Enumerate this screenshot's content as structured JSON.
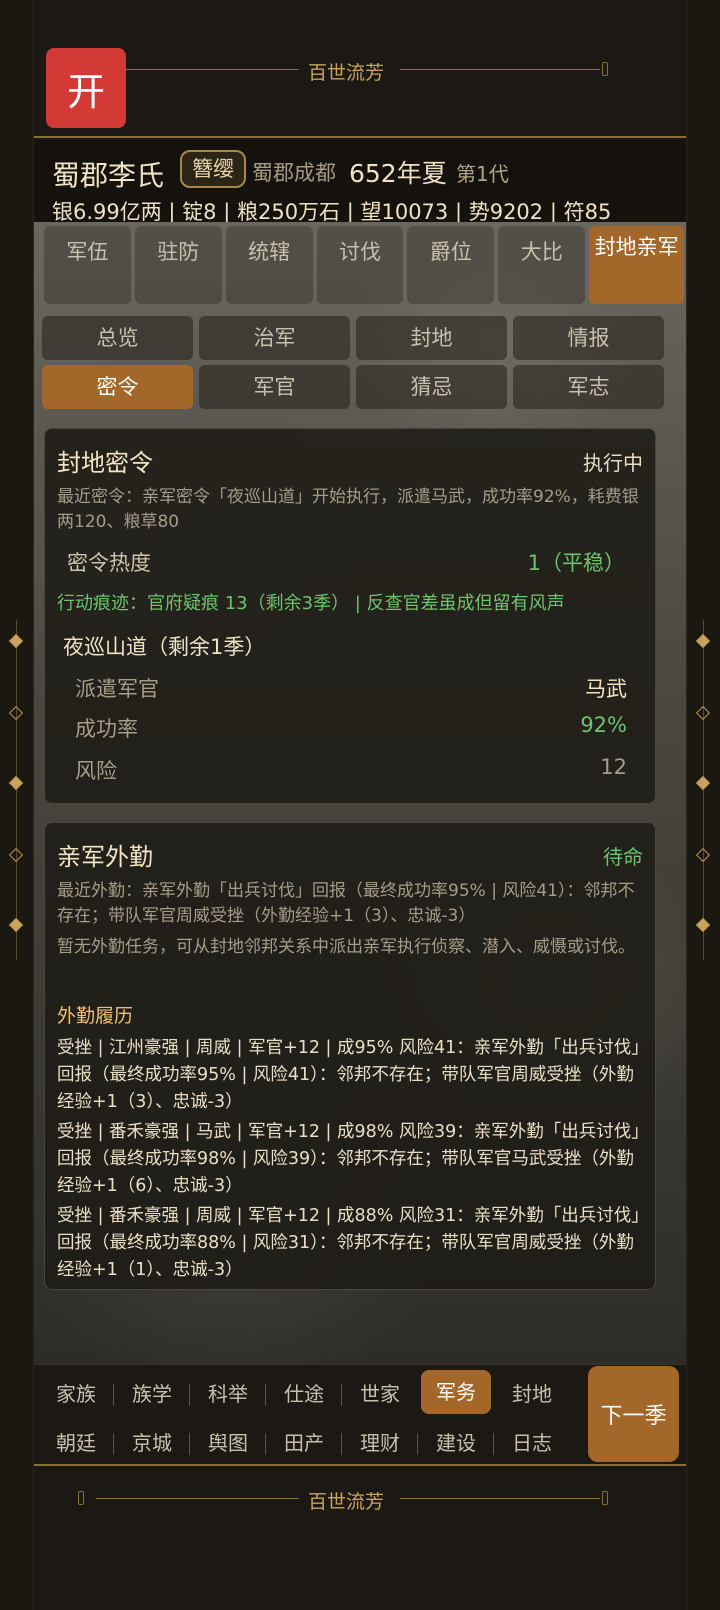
{
  "banner": {
    "title": "百世流芳"
  },
  "open_button": "开",
  "header": {
    "clan": "蜀郡李氏",
    "badge": "簪缨",
    "location": "蜀郡成都",
    "date": "652年夏",
    "generation": "第1代",
    "stats": "银6.99亿两 | 锭8 | 粮250万石 | 望10073 | 势9202 | 符85"
  },
  "tabs_primary": [
    "军伍",
    "驻防",
    "统辖",
    "讨伐",
    "爵位",
    "大比",
    "封地亲军"
  ],
  "tabs_secondary": [
    "总览",
    "治军",
    "封地",
    "情报",
    "密令",
    "军官",
    "猜忌",
    "军志"
  ],
  "active_primary": "封地亲军",
  "active_secondary": "密令",
  "decree_card": {
    "title": "封地密令",
    "status": "执行中",
    "recent": "最近密令：亲军密令「夜巡山道」开始执行，派遣马武，成功率92%，耗费银两120、粮草80",
    "heat_label": "密令热度",
    "heat_value": "1（平稳）",
    "trace": "行动痕迹：官府疑痕 13（剩余3季） | 反查官差虽成但留有风声",
    "mission_title": "夜巡山道（剩余1季）",
    "officer_label": "派遣军官",
    "officer_value": "马武",
    "success_label": "成功率",
    "success_value": "92%",
    "risk_label": "风险",
    "risk_value": "12"
  },
  "duty_card": {
    "title": "亲军外勤",
    "status": "待命",
    "recent": "最近外勤：亲军外勤「出兵讨伐」回报（最终成功率95% | 风险41）：邻邦不存在；带队军官周威受挫（外勤经验+1（3）、忠诚-3）",
    "note": "暂无外勤任务，可从封地邻邦关系中派出亲军执行侦察、潜入、威慑或讨伐。",
    "history_title": "外勤履历",
    "history": [
      "受挫 | 江州豪强 | 周威 | 军官+12 | 成95% 风险41：亲军外勤「出兵讨伐」回报（最终成功率95% | 风险41）：邻邦不存在；带队军官周威受挫（外勤经验+1（3）、忠诚-3）",
      "受挫 | 番禾豪强 | 马武 | 军官+12 | 成98% 风险39：亲军外勤「出兵讨伐」回报（最终成功率98% | 风险39）：邻邦不存在；带队军官马武受挫（外勤经验+1（6）、忠诚-3）",
      "受挫 | 番禾豪强 | 周威 | 军官+12 | 成88% 风险31：亲军外勤「出兵讨伐」回报（最终成功率88% | 风险31）：邻邦不存在；带队军官周威受挫（外勤经验+1（1）、忠诚-3）"
    ]
  },
  "bottom_nav": {
    "row1": [
      "家族",
      "族学",
      "科举",
      "仕途",
      "世家",
      "军务",
      "封地"
    ],
    "row2": [
      "朝廷",
      "京城",
      "舆图",
      "田产",
      "理财",
      "建设",
      "日志"
    ],
    "active": "军务",
    "next": "下一季"
  },
  "colors": {
    "accent": "#a4672a",
    "gold": "#c9a45a",
    "green": "#6cc46c",
    "red": "#d33a36"
  }
}
